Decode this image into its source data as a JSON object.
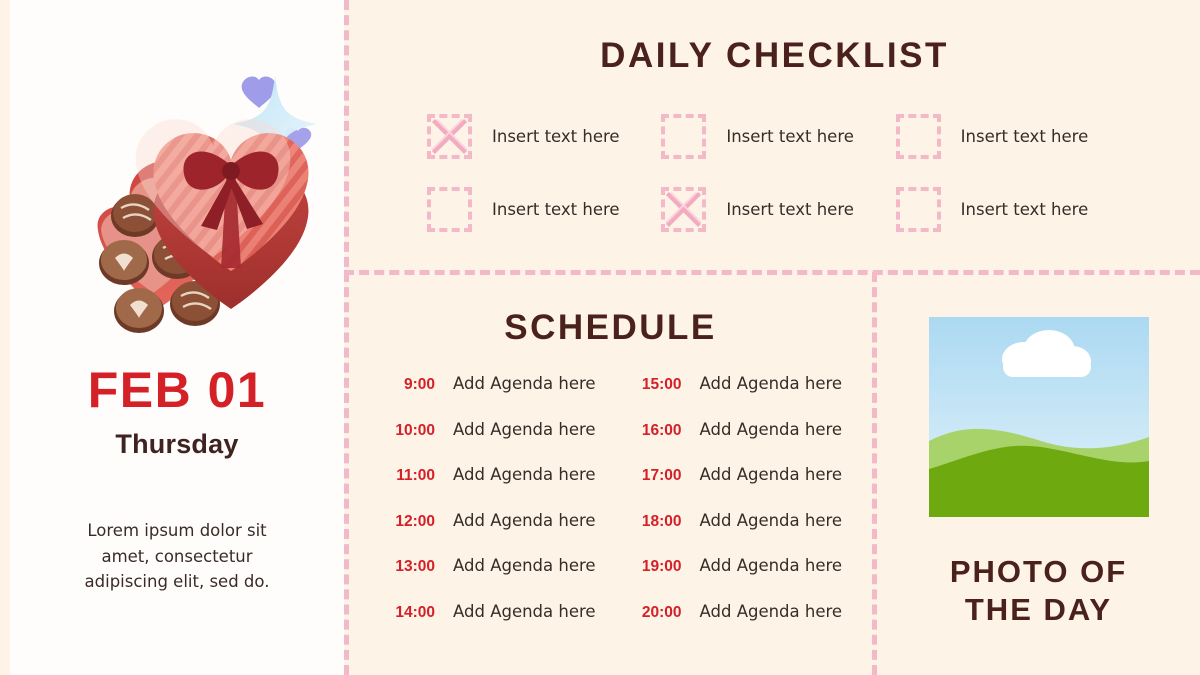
{
  "theme": {
    "background": "#FDF3E7",
    "panel_background": "#FFFDFB",
    "accent_pink": "#F3B9C8",
    "accent_red": "#D42027",
    "heading_brown": "#4A211D",
    "body_text": "#3A2B28"
  },
  "left_panel": {
    "illustration_name": "heart-chocolate-box",
    "date_main": "FEB 01",
    "date_day": "Thursday",
    "description": "Lorem ipsum dolor sit amet, consectetur adipiscing elit, sed do."
  },
  "checklist": {
    "title": "DAILY CHECKLIST",
    "items": [
      {
        "label": "Insert text here",
        "checked": true
      },
      {
        "label": "Insert text here",
        "checked": false
      },
      {
        "label": "Insert text here",
        "checked": false
      },
      {
        "label": "Insert text here",
        "checked": false
      },
      {
        "label": "Insert text here",
        "checked": true
      },
      {
        "label": "Insert text here",
        "checked": false
      }
    ]
  },
  "schedule": {
    "title": "SCHEDULE",
    "entries": [
      {
        "time": "9:00",
        "text": "Add Agenda here"
      },
      {
        "time": "15:00",
        "text": "Add Agenda here"
      },
      {
        "time": "10:00",
        "text": "Add Agenda here"
      },
      {
        "time": "16:00",
        "text": "Add Agenda here"
      },
      {
        "time": "11:00",
        "text": "Add Agenda here"
      },
      {
        "time": "17:00",
        "text": "Add Agenda here"
      },
      {
        "time": "12:00",
        "text": "Add Agenda here"
      },
      {
        "time": "18:00",
        "text": "Add Agenda here"
      },
      {
        "time": "13:00",
        "text": "Add Agenda here"
      },
      {
        "time": "19:00",
        "text": "Add Agenda here"
      },
      {
        "time": "14:00",
        "text": "Add Agenda here"
      },
      {
        "time": "20:00",
        "text": "Add Agenda here"
      }
    ]
  },
  "photo_of_the_day": {
    "caption_line_1": "PHOTO OF",
    "caption_line_2": "THE DAY",
    "placeholder_image_name": "landscape-placeholder-image"
  }
}
